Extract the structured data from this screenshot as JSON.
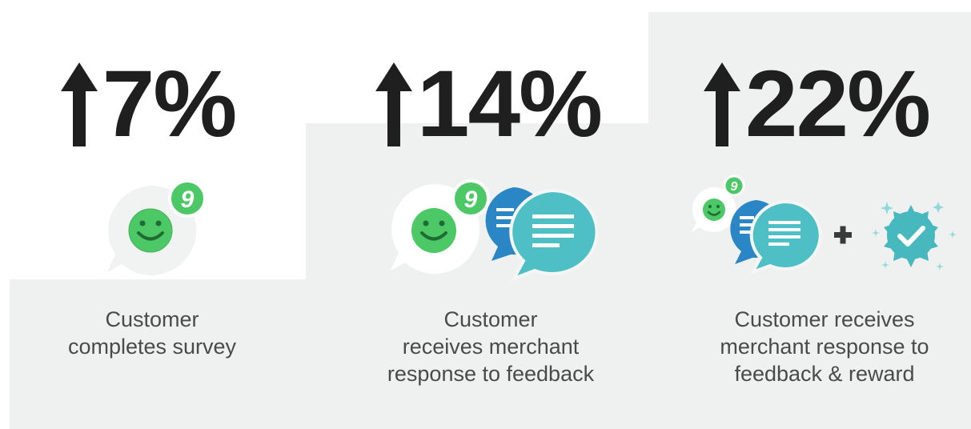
{
  "colors": {
    "background": "#ffffff",
    "step_gray": "#eff1f0",
    "text_dark": "#1f1f1f",
    "caption_text": "#4a4a4a",
    "green": "#4cc866",
    "blue": "#2b86c6",
    "teal": "#4dbfc5",
    "badge_teal": "#46b8be"
  },
  "stages": [
    {
      "stat": "7%",
      "direction": "up",
      "icons": [
        "smiley-chat-bubble-icon",
        "notification-badge-icon"
      ],
      "badge": "9",
      "caption": [
        "Customer",
        "completes survey"
      ]
    },
    {
      "stat": "14%",
      "direction": "up",
      "icons": [
        "smiley-chat-bubble-icon",
        "notification-badge-icon",
        "response-chat-bubble-icon"
      ],
      "badge": "9",
      "caption": [
        "Customer",
        "receives merchant",
        "response to feedback"
      ]
    },
    {
      "stat": "22%",
      "direction": "up",
      "icons": [
        "smiley-chat-bubble-icon",
        "notification-badge-icon",
        "response-chat-bubble-icon",
        "plus-icon",
        "reward-badge-icon"
      ],
      "badge": "9",
      "caption": [
        "Customer receives",
        "merchant response to",
        "feedback & reward"
      ]
    }
  ]
}
